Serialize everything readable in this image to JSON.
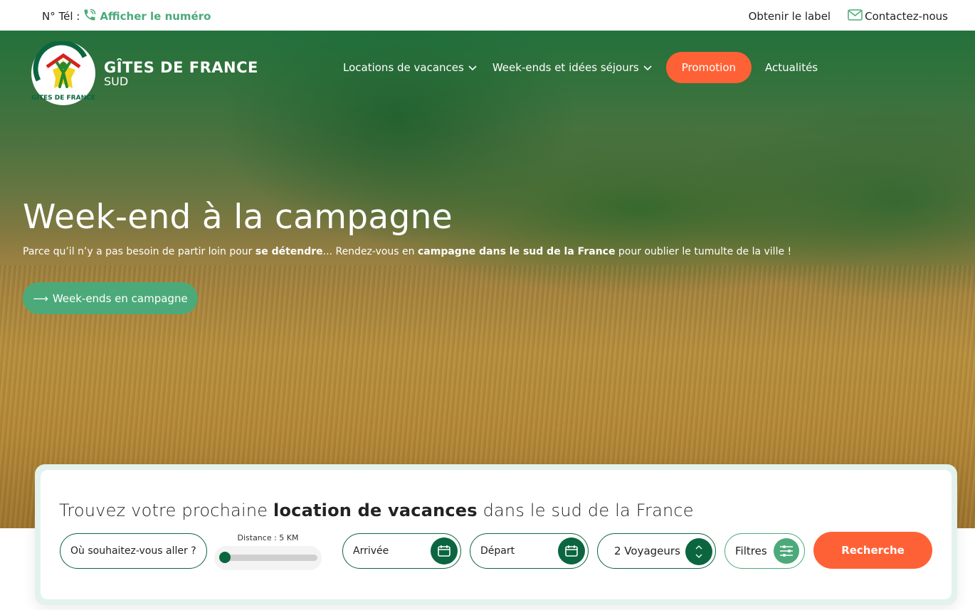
{
  "topbar": {
    "tel_label": "N° Tél :",
    "tel_link": "Afficher le numéro",
    "label_link": "Obtenir le label",
    "contact_link": "Contactez-nous"
  },
  "logo": {
    "brand_line1": "GÎTES DE FRANCE",
    "brand_line2": "SUD",
    "badge_text": "GÎTES DE FRANCE"
  },
  "nav": {
    "items": [
      {
        "label": "Locations de vacances",
        "has_dropdown": true
      },
      {
        "label": "Week-ends et idées séjours",
        "has_dropdown": true
      }
    ],
    "promo_label": "Promotion",
    "news_label": "Actualités"
  },
  "hero": {
    "title": "Week-end à la campagne",
    "subtitle_parts": [
      {
        "text": "Parce qu’il n’y a pas besoin de partir loin pour ",
        "bold": false
      },
      {
        "text": "se détendre",
        "bold": true
      },
      {
        "text": "... Rendez-vous en ",
        "bold": false
      },
      {
        "text": "campagne dans le sud de la France",
        "bold": true
      },
      {
        "text": " pour oublier le tumulte de la ville !",
        "bold": false
      }
    ],
    "cta_arrow": "⟶",
    "cta_label": "Week-ends en campagne"
  },
  "search": {
    "title_pre": "Trouvez votre prochaine ",
    "title_bold": "location de vacances",
    "title_post": " dans le sud de la France",
    "where_placeholder": "Où souhaitez-vous aller ?",
    "distance_label": "Distance : 5 KM",
    "distance_km": 5,
    "distance_fraction": 0.0,
    "arrival_label": "Arrivée",
    "departure_label": "Départ",
    "travelers_value": "2 Voyageurs",
    "filters_label": "Filtres",
    "search_button": "Recherche"
  },
  "colors": {
    "brand_green": "#0b6640",
    "accent_green": "#4caa7a",
    "promo_orange": "#ff6136"
  },
  "icons": {
    "phone": "phone-icon",
    "mail": "mail-icon",
    "chevron": "chevron-down-icon",
    "calendar": "calendar-icon",
    "updown": "chevron-up-down-icon",
    "filters": "sliders-icon"
  }
}
